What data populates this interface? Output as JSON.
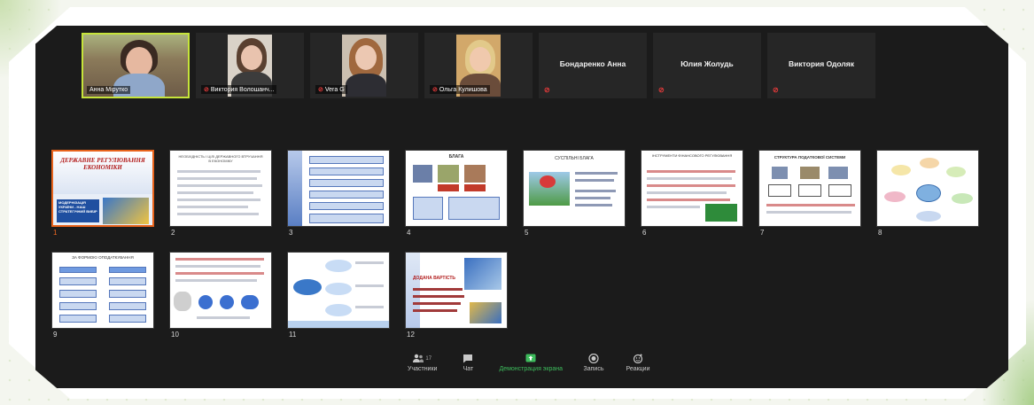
{
  "participants": [
    {
      "name": "Анна Мірутко",
      "has_video": true,
      "active": true
    },
    {
      "name": "Виктория Волошанч...",
      "has_video": true,
      "active": false
    },
    {
      "name": "Vera G",
      "has_video": true,
      "active": false
    },
    {
      "name": "Ольга Кулишова",
      "has_video": true,
      "active": false
    },
    {
      "name": "Бондаренко Анна",
      "has_video": false,
      "active": false
    },
    {
      "name": "Юлия Жолудь",
      "has_video": false,
      "active": false
    },
    {
      "name": "Виктория Одоляк",
      "has_video": false,
      "active": false
    }
  ],
  "slides": {
    "numbers": [
      "1",
      "2",
      "3",
      "4",
      "5",
      "6",
      "7",
      "8",
      "9",
      "10",
      "11",
      "12"
    ],
    "s1": {
      "title": "ДЕРЖАВНЕ РЕГУЛЮВАННЯ ЕКОНОМІКИ",
      "subtitle": "МОДЕРНІЗАЦІЯ УКРАЇНИ - НАШ СТРАТЕГІЧНИЙ ВИБІР"
    },
    "s2": {
      "title": "НЕОБХІДНІСТЬ І ЦІЛІ ДЕРЖАВНОГО ВТРУЧАННЯ В ЕКОНОМІКУ"
    },
    "s4": {
      "title": "БЛАГА"
    },
    "s5": {
      "title": "СУСПІЛЬНІ БЛАГА"
    },
    "s6": {
      "title": "ІНСТРУМЕНТИ ФІНАНСОВОГО РЕГУЛЮВАННЯ"
    },
    "s7": {
      "title": "СТРУКТУРА ПОДАТКОВОЇ СИСТЕМИ"
    },
    "s9": {
      "title": "ЗА ФОРМОЮ ОПОДАТКУВАННЯ"
    },
    "s12": {
      "title": "ДОДАНА ВАРТІСТЬ"
    }
  },
  "toolbar": {
    "participants_label": "Участники",
    "participants_count": "17",
    "chat_label": "Чат",
    "share_label": "Демонстрация экрана",
    "record_label": "Запись",
    "reactions_label": "Реакции"
  },
  "colors": {
    "active_border": "#c6e43a",
    "selected_slide": "#e8631c",
    "share_green": "#3dbb5c",
    "mic_off": "#e23a3a"
  }
}
